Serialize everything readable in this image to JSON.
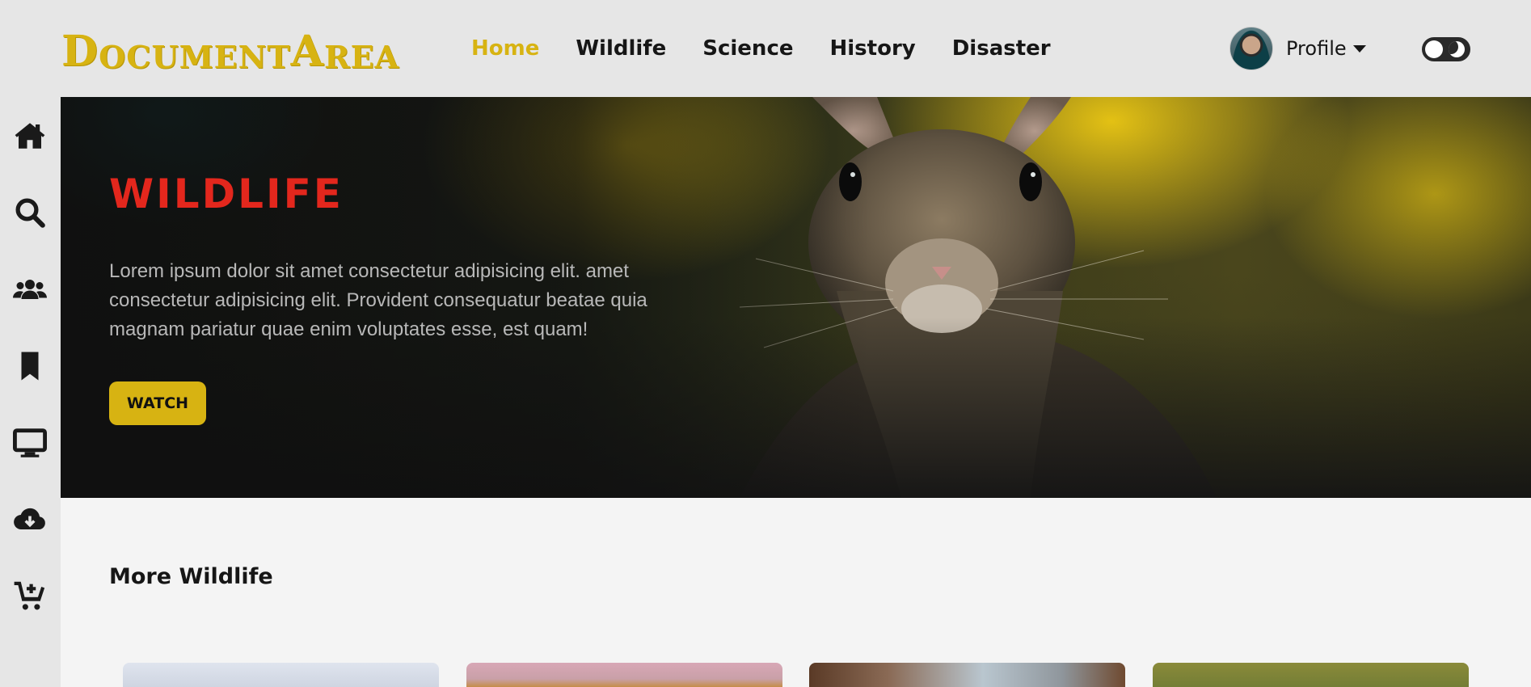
{
  "brand": {
    "logo_text": "DocumentArea",
    "accent_color": "#d7b312"
  },
  "nav": {
    "items": [
      {
        "label": "Home",
        "active": true
      },
      {
        "label": "Wildlife",
        "active": false
      },
      {
        "label": "Science",
        "active": false
      },
      {
        "label": "History",
        "active": false
      },
      {
        "label": "Disaster",
        "active": false
      }
    ]
  },
  "profile": {
    "label": "Profile",
    "avatar": "user-avatar",
    "caret": "caret-down-icon"
  },
  "theme_toggle": {
    "icon": "moon-icon",
    "state": "light"
  },
  "sidebar": {
    "icons": [
      "home-icon",
      "search-icon",
      "users-icon",
      "bookmark-icon",
      "desktop-icon",
      "cloud-download-icon",
      "cart-plus-icon"
    ]
  },
  "hero": {
    "title": "WILDLIFE",
    "title_color": "#e3271d",
    "description": "Lorem ipsum dolor sit amet consectetur adipisicing elit. amet consectetur adipisicing elit. Provident consequatur beatae quia magnam pariatur quae enim voluptates esse, est quam!",
    "button_label": "WATCH"
  },
  "more_section": {
    "title": "More Wildlife",
    "cards": [
      "wildlife-card-1",
      "wildlife-card-2",
      "wildlife-card-3",
      "wildlife-card-4"
    ]
  }
}
